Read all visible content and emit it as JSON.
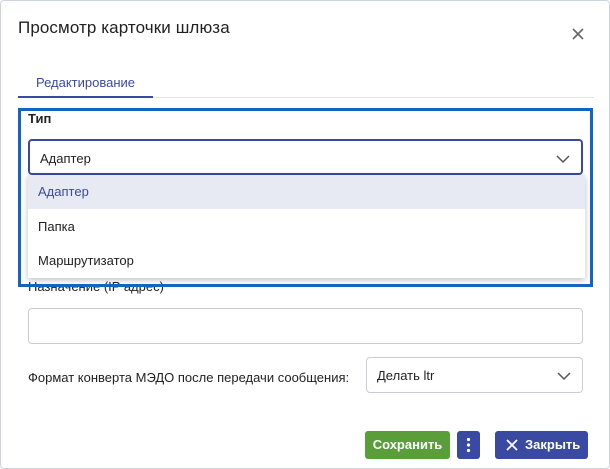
{
  "dialog": {
    "title": "Просмотр карточки шлюза"
  },
  "tabs": [
    {
      "label": "Редактирование",
      "active": true
    }
  ],
  "type_field": {
    "label": "Тип",
    "value": "Адаптер",
    "options": [
      "Адаптер",
      "Папка",
      "Маршрутизатор"
    ]
  },
  "ip_field": {
    "label": "Назначение (IP адрес)",
    "value": ""
  },
  "format_field": {
    "label": "Формат конверта МЭДО после передачи сообщения:",
    "value": "Делать ltr"
  },
  "buttons": {
    "save": "Сохранить",
    "close": "Закрыть"
  },
  "colors": {
    "accent": "#3a4aa3",
    "save": "#5a9e3a",
    "focus_frame": "#1565c0"
  },
  "icons": [
    "close-icon",
    "chevron-down-icon",
    "more-vertical-icon",
    "x-icon"
  ]
}
